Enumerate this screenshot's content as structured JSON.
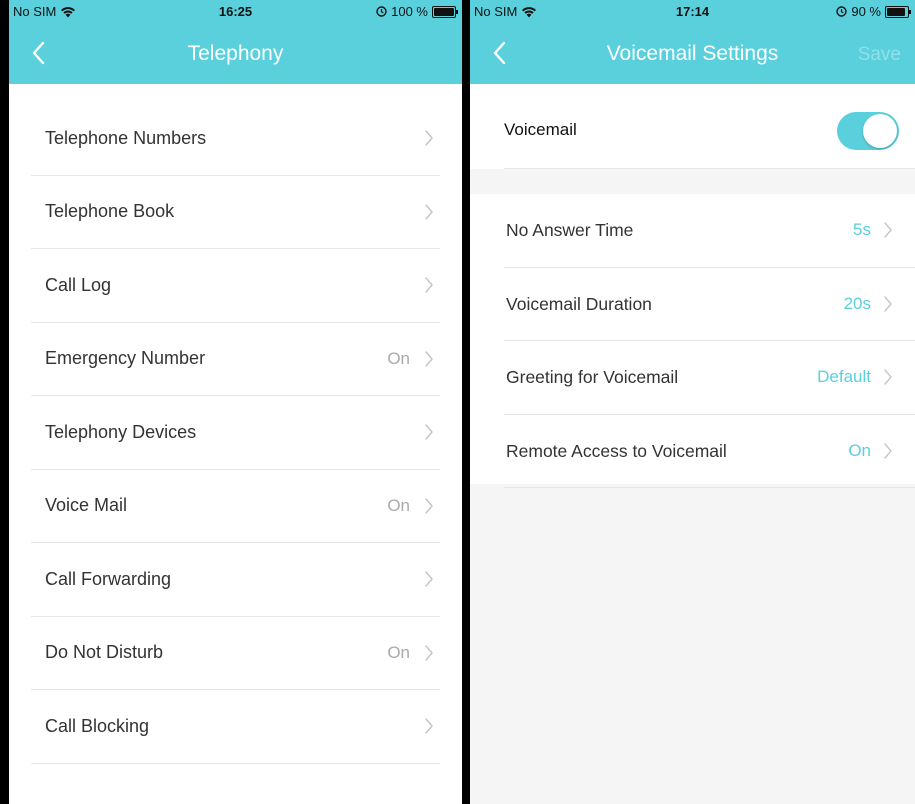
{
  "left_screen": {
    "status": {
      "carrier": "No SIM",
      "time": "16:25",
      "battery_text": "100 %",
      "battery_level": 1.0
    },
    "title": "Telephony",
    "items": [
      {
        "label": "Telephone Numbers",
        "value": ""
      },
      {
        "label": "Telephone Book",
        "value": ""
      },
      {
        "label": "Call Log",
        "value": ""
      },
      {
        "label": "Emergency Number",
        "value": "On"
      },
      {
        "label": "Telephony Devices",
        "value": ""
      },
      {
        "label": "Voice Mail",
        "value": "On"
      },
      {
        "label": "Call Forwarding",
        "value": ""
      },
      {
        "label": "Do Not Disturb",
        "value": "On"
      },
      {
        "label": "Call Blocking",
        "value": ""
      }
    ]
  },
  "right_screen": {
    "status": {
      "carrier": "No SIM",
      "time": "17:14",
      "battery_text": "90 %",
      "battery_level": 0.9
    },
    "title": "Voicemail Settings",
    "save_label": "Save",
    "voicemail_label": "Voicemail",
    "voicemail_enabled": true,
    "settings": [
      {
        "label": "No Answer Time",
        "value": "5s"
      },
      {
        "label": "Voicemail Duration",
        "value": "20s"
      },
      {
        "label": "Greeting for Voicemail",
        "value": "Default"
      },
      {
        "label": "Remote Access to Voicemail",
        "value": "On"
      }
    ]
  },
  "colors": {
    "accent": "#5ad0dc",
    "text": "#333333",
    "muted": "#aaaaaa"
  },
  "icons": [
    "wifi-icon",
    "alarm-icon",
    "battery-icon",
    "back-chevron-icon",
    "chevron-right-icon"
  ]
}
